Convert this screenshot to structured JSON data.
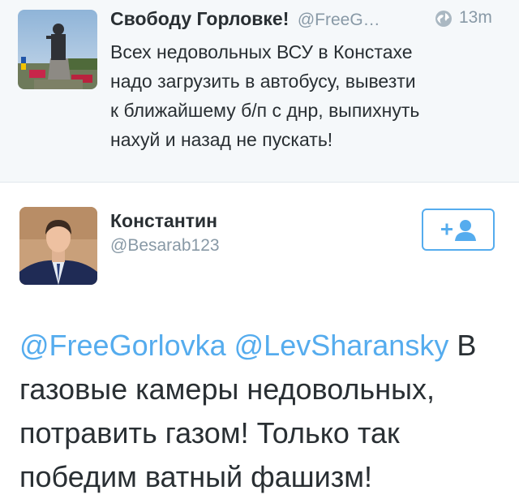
{
  "top_tweet": {
    "name": "Свободу Горловке!",
    "handle": "@FreeG…",
    "time": "13m",
    "lines": [
      "Всех недовольных ВСУ в Констахе",
      "надо загрузить в автобусу, вывезти",
      "к ближайшему б/п с днр, выпихнуть",
      "нахуй и назад не пускать!"
    ]
  },
  "focus_tweet": {
    "name": "Константин",
    "handle": "@Besarab123",
    "follow_icon": "add-user-icon",
    "mention1": "@FreeGorlovka",
    "mention2": "@LevSharansky",
    "line1_rest": " В",
    "lines": [
      "газовые камеры недовольных,",
      "потравить газом! Только так",
      "победим ватный фашизм!"
    ]
  },
  "colors": {
    "accent": "#55acee",
    "secondary_text": "#8899a6",
    "text": "#292f33",
    "top_background": "#f5f8fa"
  }
}
